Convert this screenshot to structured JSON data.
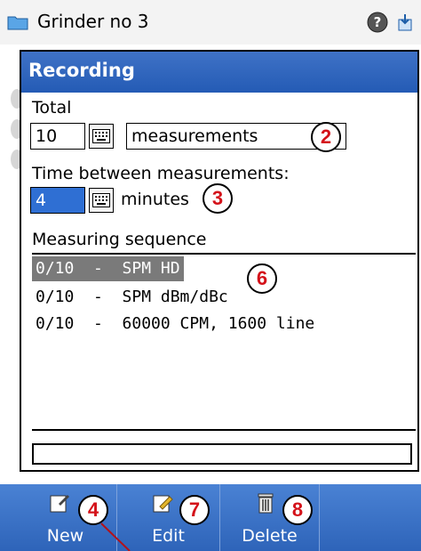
{
  "window": {
    "title": "Grinder no 3"
  },
  "dialog": {
    "title": "Recording",
    "total_label": "Total",
    "total_value": "10",
    "total_unit": "measurements",
    "interval_label": "Time between measurements:",
    "interval_value": "4",
    "interval_unit": "minutes",
    "sequence_label": "Measuring sequence",
    "sequence": [
      {
        "text": "0/10  -  SPM HD",
        "selected": true
      },
      {
        "text": "0/10  -  SPM dBm/dBc",
        "selected": false
      },
      {
        "text": "0/10  -  60000 CPM, 1600 line",
        "selected": false
      }
    ],
    "status_value": ""
  },
  "toolbar": {
    "new_label": "New",
    "edit_label": "Edit",
    "delete_label": "Delete"
  },
  "callouts": {
    "c2": "2",
    "c3": "3",
    "c4": "4",
    "c6": "6",
    "c7": "7",
    "c8": "8"
  },
  "colors": {
    "header_blue": "#245bb5",
    "toolbar_blue": "#2e64b9",
    "selection_blue": "#2f6fd3",
    "callout_red": "#d4121a"
  },
  "icons": [
    "folder-icon",
    "help-icon",
    "export-icon",
    "keyboard-icon",
    "new-icon",
    "edit-icon",
    "delete-icon"
  ]
}
